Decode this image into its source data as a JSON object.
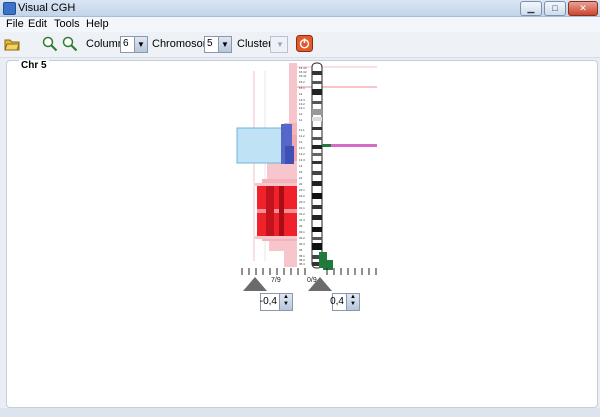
{
  "window": {
    "title": "Visual CGH"
  },
  "menu": {
    "items": [
      "File",
      "Edit",
      "Tools",
      "Help"
    ]
  },
  "toolbar": {
    "columns_label": "Columns",
    "columns_value": "6",
    "chromosome_label": "Chromosome",
    "chromosome_value": "5",
    "cluster_label": "Cluster",
    "cluster_value": ""
  },
  "panel": {
    "title": "Chr 5"
  },
  "controls": {
    "left_scale_label": "7/9",
    "right_scale_label": "0/9",
    "left_threshold": "-0,4",
    "right_threshold": "0,4"
  },
  "colors": {
    "loss_pink": "#f4b3bb",
    "gain_red": "#f0212a",
    "highlight_blue": "#bfe3f4",
    "blue_band": "#5567c8",
    "marker_green": "#1f7a3b",
    "marker_pink": "#d86bc6"
  }
}
